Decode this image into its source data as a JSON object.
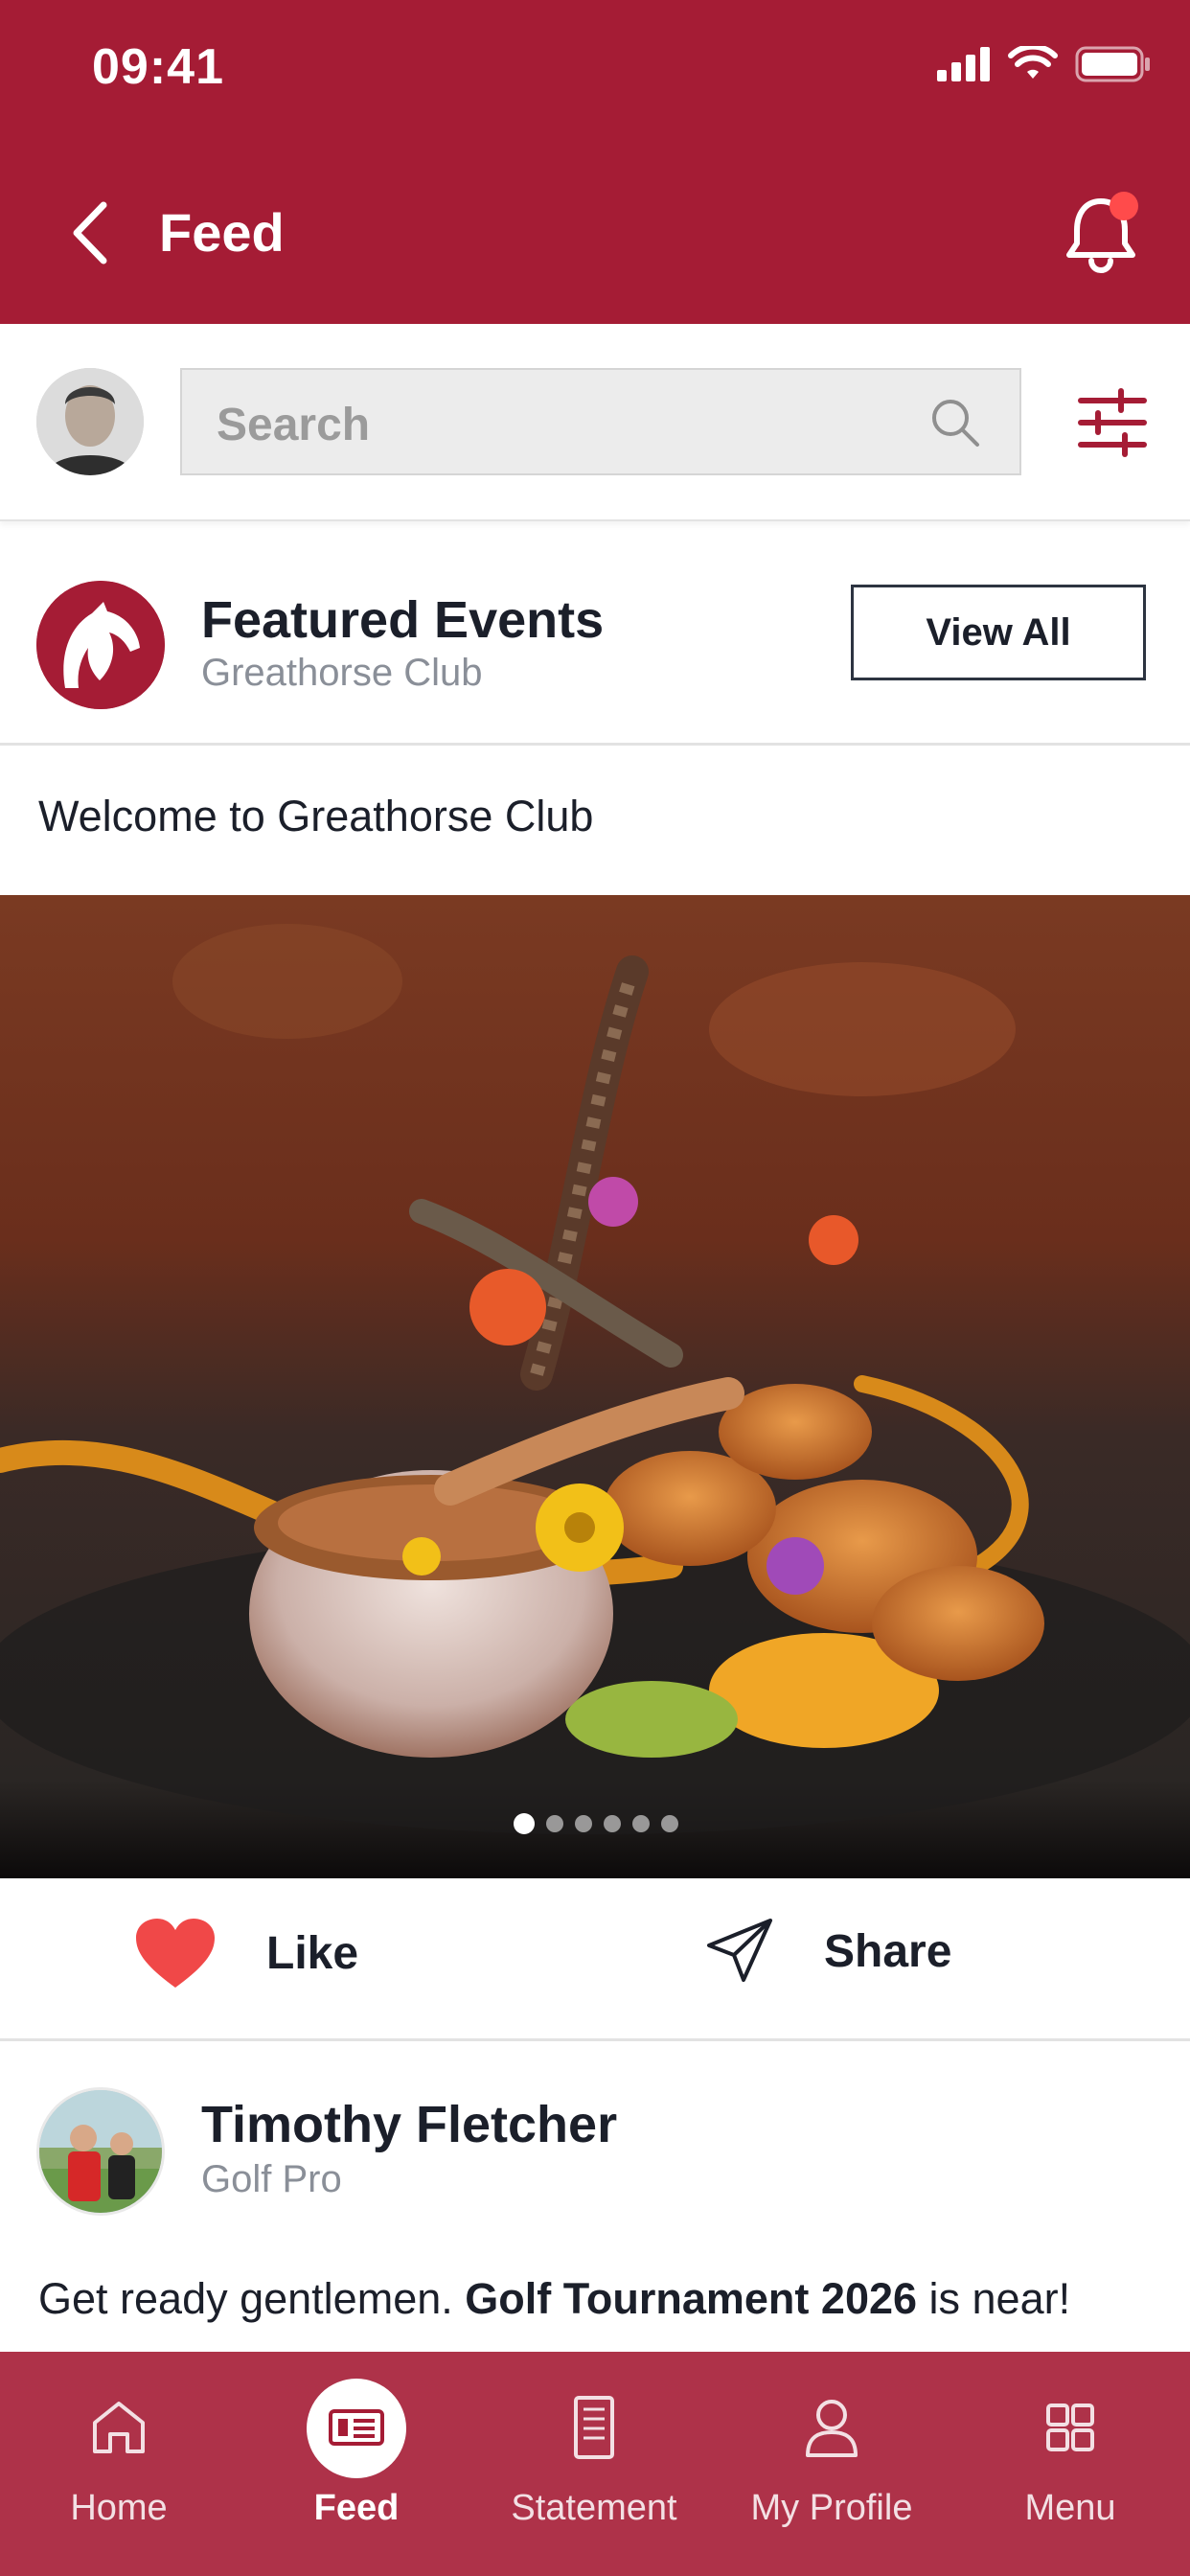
{
  "status_bar": {
    "time": "09:41"
  },
  "header": {
    "title": "Feed"
  },
  "search": {
    "placeholder": "Search"
  },
  "featured": {
    "title": "Featured Events",
    "subtitle": "Greathorse Club",
    "view_all_label": "View All"
  },
  "welcome_text": "Welcome to Greathorse Club",
  "carousel": {
    "slide_count": 6,
    "active_index": 0
  },
  "actions": {
    "like_label": "Like",
    "share_label": "Share"
  },
  "post": {
    "author": "Timothy Fletcher",
    "role": "Golf Pro",
    "text_plain": "Get ready gentlemen. ",
    "text_bold": "Golf Tournament 2026",
    "text_tail": " is near!"
  },
  "tabbar": {
    "items": [
      {
        "label": "Home",
        "icon": "home-icon"
      },
      {
        "label": "Feed",
        "icon": "feed-icon"
      },
      {
        "label": "Statement",
        "icon": "statement-icon"
      },
      {
        "label": "My Profile",
        "icon": "profile-icon"
      },
      {
        "label": "Menu",
        "icon": "grid-icon"
      }
    ],
    "active": "Feed"
  },
  "colors": {
    "brand": "#a51c35",
    "like": "#f04848",
    "notification_dot": "#ff4b4b"
  }
}
